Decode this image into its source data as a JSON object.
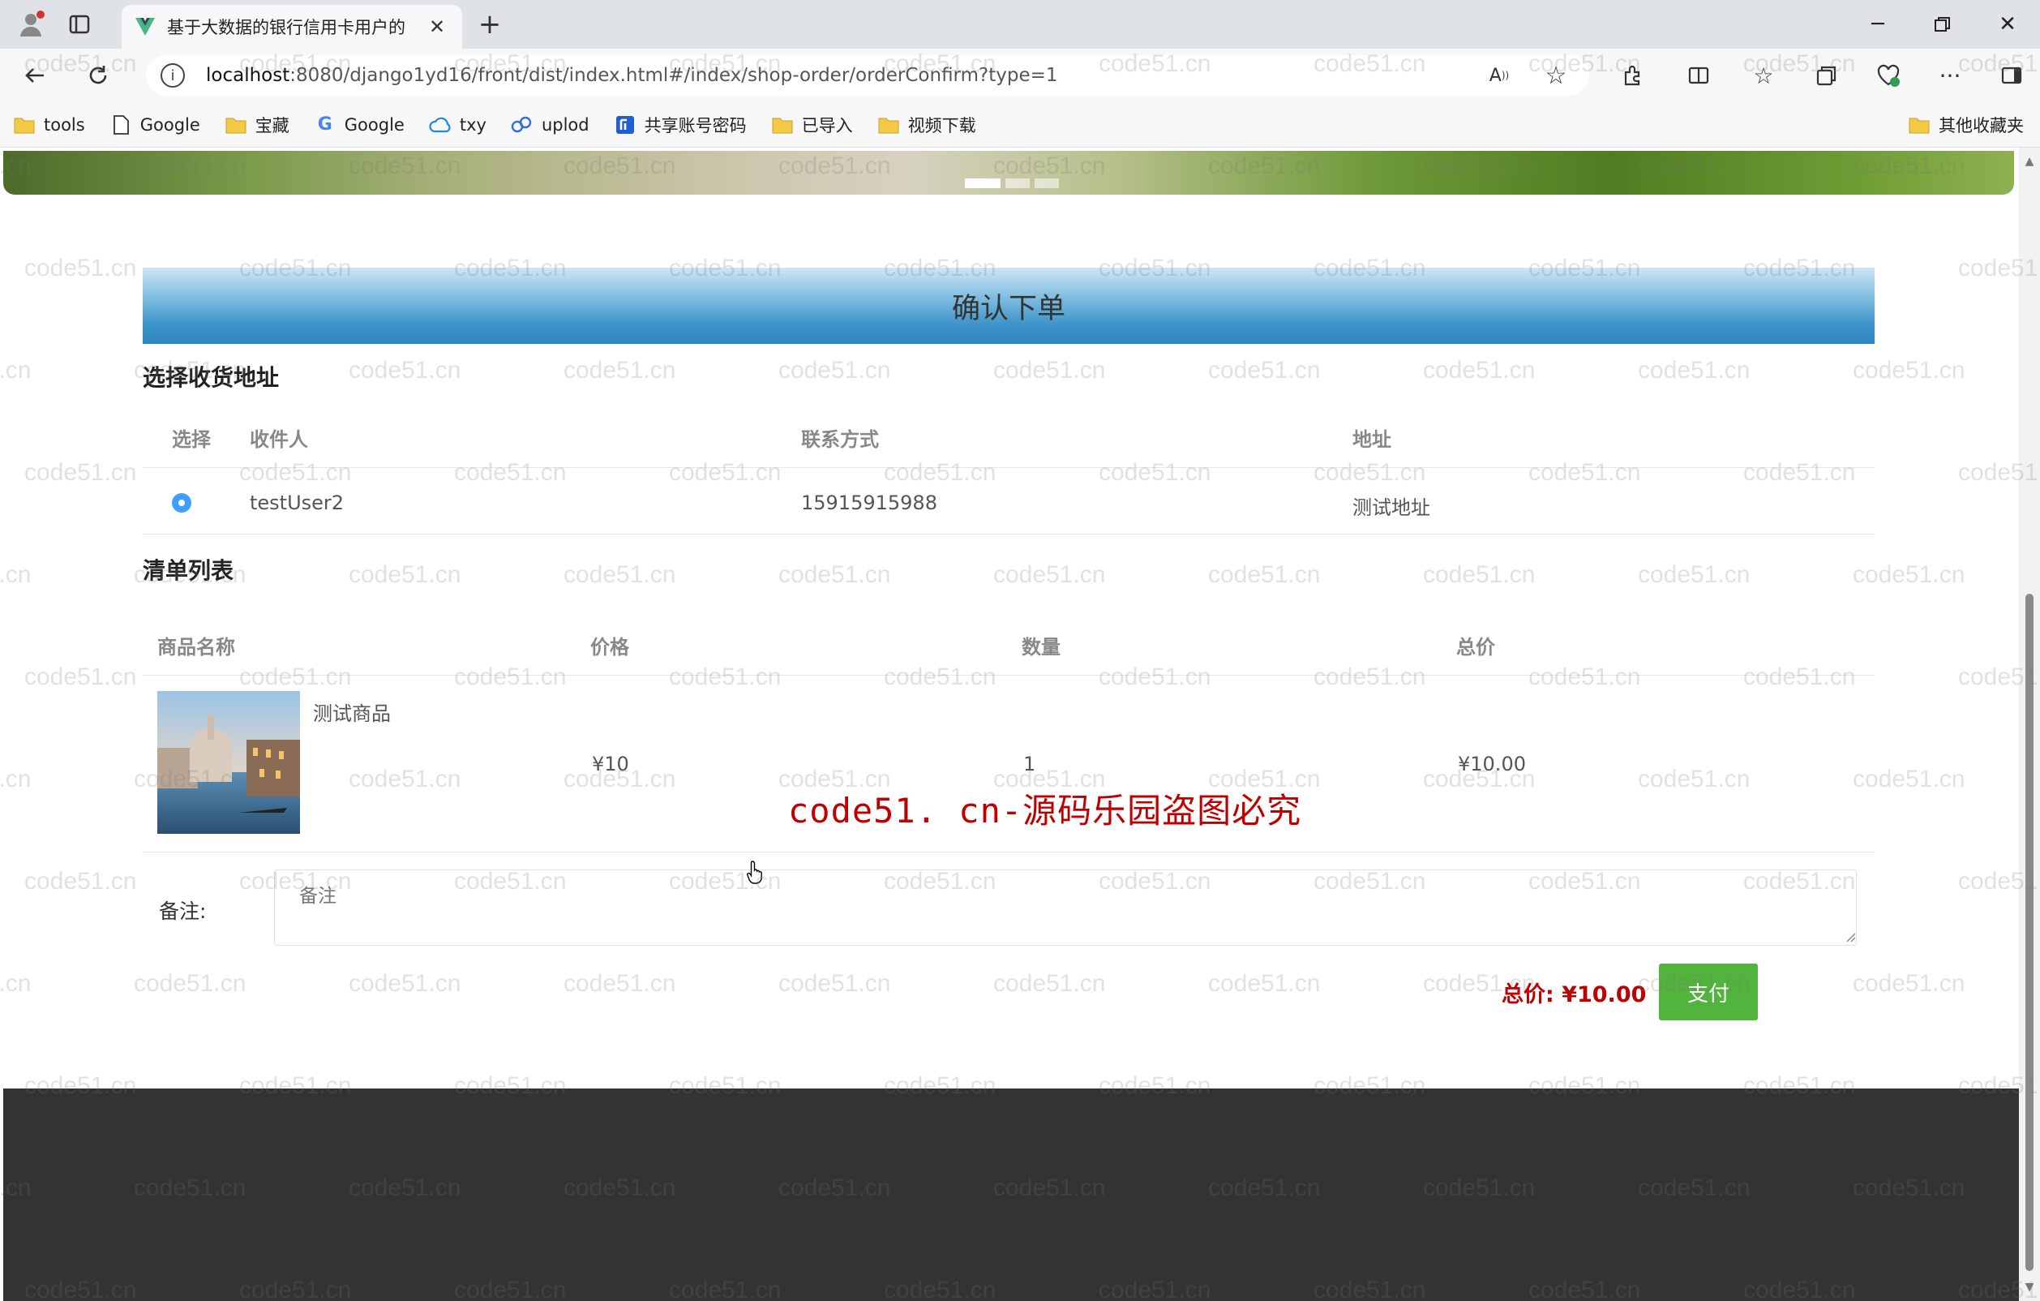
{
  "browser": {
    "tab_title": "基于大数据的银行信用卡用户的",
    "url_host": "localhost",
    "url_rest": ":8080/django1yd16/front/dist/index.html#/index/shop-order/orderConfirm?type=1",
    "bookmarks": [
      {
        "label": "tools",
        "icon": "folder-icon"
      },
      {
        "label": "Google",
        "icon": "page-icon"
      },
      {
        "label": "宝藏",
        "icon": "folder-icon"
      },
      {
        "label": "Google",
        "icon": "google-icon"
      },
      {
        "label": "txy",
        "icon": "cloud-icon"
      },
      {
        "label": "uplod",
        "icon": "uplod-icon"
      },
      {
        "label": "共享账号密码",
        "icon": "share-icon"
      },
      {
        "label": "已导入",
        "icon": "folder-icon"
      },
      {
        "label": "视频下载",
        "icon": "folder-icon"
      }
    ],
    "other_bookmarks": "其他收藏夹"
  },
  "page": {
    "header": "确认下单",
    "address_section": "选择收货地址",
    "address_table": {
      "headers": [
        "选择",
        "收件人",
        "联系方式",
        "地址"
      ],
      "rows": [
        {
          "recipient": "testUser2",
          "phone": "15915915988",
          "address": "测试地址",
          "selected": true
        }
      ]
    },
    "list_section": "清单列表",
    "order_table": {
      "headers": [
        "商品名称",
        "价格",
        "数量",
        "总价"
      ],
      "rows": [
        {
          "name": "测试商品",
          "price": "¥10",
          "quantity": "1",
          "total": "¥10.00"
        }
      ]
    },
    "remark_label": "备注:",
    "remark_placeholder": "备注",
    "total_label": "总价: ¥10.00",
    "pay_button": "支付",
    "watermark_text": "code51.cn",
    "red_watermark": "code51. cn-源码乐园盗图必究"
  },
  "colors": {
    "accent_blue": "#409eff",
    "pay_green": "#52b43c",
    "total_red": "#c00000",
    "footer": "#333333"
  }
}
